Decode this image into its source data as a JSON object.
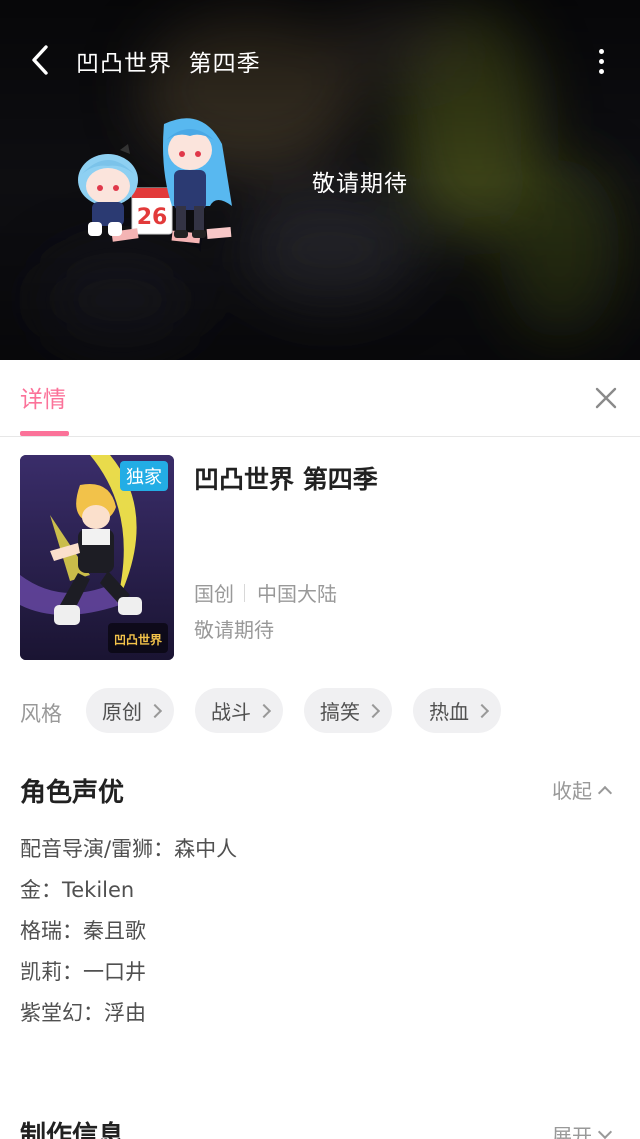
{
  "header": {
    "title": "凹凸世界  第四季",
    "status": "敬请期待"
  },
  "tabs": {
    "detail_label": "详情"
  },
  "info": {
    "title": "凹凸世界 第四季",
    "badge": "独家",
    "category": "国创",
    "region": "中国大陆",
    "status": "敬请期待",
    "cover_logo_text": "凹凸世界"
  },
  "style": {
    "label": "风格",
    "tags": [
      "原创",
      "战斗",
      "搞笑",
      "热血"
    ]
  },
  "cast": {
    "title": "角色声优",
    "toggle_label": "收起",
    "lines": [
      "配音导演/雷狮：森中人",
      "金：Tekilen",
      "格瑞：秦且歌",
      "凯莉：一口井",
      "紫堂幻：浮由"
    ]
  },
  "production": {
    "title": "制作信息",
    "toggle_label": "展开"
  },
  "colors": {
    "accent": "#fb7299",
    "badge": "#23ade5",
    "secondary_text": "#999999"
  },
  "icons": {
    "back": "chevron-left-icon",
    "more": "more-vertical-icon",
    "close": "close-icon",
    "tag_arrow": "chevron-right-icon",
    "collapse": "chevron-up-icon",
    "expand": "chevron-down-icon"
  }
}
